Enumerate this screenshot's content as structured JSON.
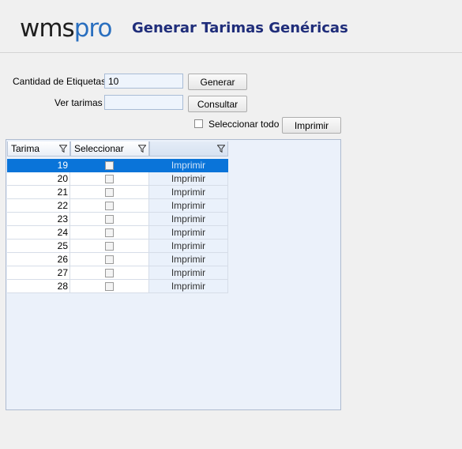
{
  "header": {
    "logo_a": "wms",
    "logo_b": "pro",
    "title": "Generar Tarimas Genéricas"
  },
  "form": {
    "cantidad_label": "Cantidad de Etiquetas",
    "cantidad_value": "10",
    "ver_label": "Ver tarimas",
    "ver_value": "",
    "generar_label": "Generar",
    "consultar_label": "Consultar",
    "seleccionar_todo_label": "Seleccionar todo",
    "imprimir_label": "Imprimir"
  },
  "grid": {
    "columns": [
      "Tarima",
      "Seleccionar",
      ""
    ],
    "selected_row": 0,
    "rows": [
      {
        "tarima": "19",
        "accion": "Imprimir"
      },
      {
        "tarima": "20",
        "accion": "Imprimir"
      },
      {
        "tarima": "21",
        "accion": "Imprimir"
      },
      {
        "tarima": "22",
        "accion": "Imprimir"
      },
      {
        "tarima": "23",
        "accion": "Imprimir"
      },
      {
        "tarima": "24",
        "accion": "Imprimir"
      },
      {
        "tarima": "25",
        "accion": "Imprimir"
      },
      {
        "tarima": "26",
        "accion": "Imprimir"
      },
      {
        "tarima": "27",
        "accion": "Imprimir"
      },
      {
        "tarima": "28",
        "accion": "Imprimir"
      }
    ]
  },
  "colors": {
    "brand": "#2a6fbf",
    "title": "#1f2d7a",
    "selection": "#0a74d9"
  }
}
